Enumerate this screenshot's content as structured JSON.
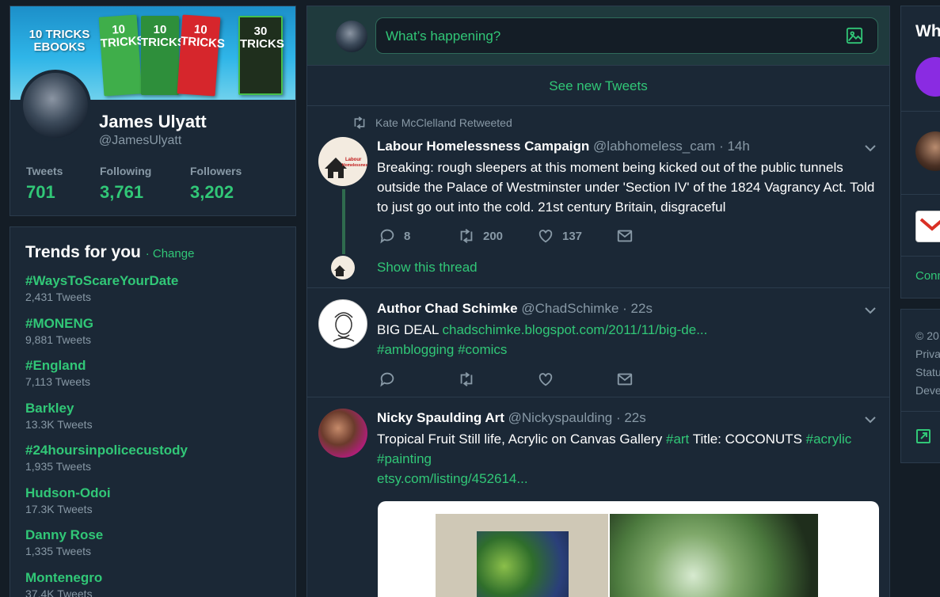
{
  "profile": {
    "banner_title": "10 TRICKS EBOOKS",
    "books": [
      "10 TRICKS",
      "10 TRICKS",
      "10 TRICKS",
      "30 TRICKS"
    ],
    "name": "James Ulyatt",
    "handle": "@JamesUlyatt",
    "stats": [
      {
        "label": "Tweets",
        "value": "701"
      },
      {
        "label": "Following",
        "value": "3,761"
      },
      {
        "label": "Followers",
        "value": "3,202"
      }
    ]
  },
  "trends": {
    "title": "Trends for you",
    "change": "· Change",
    "items": [
      {
        "name": "#WaysToScareYourDate",
        "count": "2,431 Tweets"
      },
      {
        "name": "#MONENG",
        "count": "9,881 Tweets"
      },
      {
        "name": "#England",
        "count": "7,113 Tweets"
      },
      {
        "name": "Barkley",
        "count": "13.3K Tweets"
      },
      {
        "name": "#24hoursinpolicecustody",
        "count": "1,935 Tweets"
      },
      {
        "name": "Hudson-Odoi",
        "count": "17.3K Tweets"
      },
      {
        "name": "Danny Rose",
        "count": "1,335 Tweets"
      },
      {
        "name": "Montenegro",
        "count": "37.4K Tweets"
      }
    ]
  },
  "compose": {
    "placeholder": "What’s happening?"
  },
  "see_new": "See new Tweets",
  "tweets": [
    {
      "context": "Kate McClelland Retweeted",
      "name": "Labour Homelessness Campaign",
      "handle": "@labhomeless_cam",
      "time": "· 14h",
      "avatar_text": "Labour Homelessness Campaign",
      "body": "Breaking: rough sleepers at this moment being kicked out of the public tunnels outside the Palace of Westminster under 'Section IV' of the 1824 Vagrancy Act. Told to just go out into the cold. 21st century Britain, disgraceful",
      "replies": "8",
      "retweets": "200",
      "likes": "137",
      "show_thread": "Show this thread"
    },
    {
      "name": "Author Chad Schimke",
      "handle": "@ChadSchimke",
      "time": "· 22s",
      "body_text": "BIG DEAL ",
      "link": "chadschimke.blogspot.com/2011/11/big-de...",
      "hashtags": "#amblogging #comics"
    },
    {
      "name": "Nicky Spaulding Art",
      "handle": "@Nickyspaulding",
      "time": "· 22s",
      "body_1": "Tropical Fruit Still life, Acrylic on Canvas Gallery ",
      "tag_1": "#art",
      "body_2": " Title: COCONUTS ",
      "tag_2": "#acrylic",
      "tag_3": "#painting",
      "link": "etsy.com/listing/452614..."
    }
  ],
  "right": {
    "heading_fragment": "Wh",
    "connect_fragment": "Conn",
    "footer": [
      "© 20",
      "Priva",
      "Statu",
      "Deve"
    ]
  },
  "colors": {
    "accent": "#31c777",
    "background": "#141d26",
    "panel": "#1b2836",
    "muted": "#8899a6"
  }
}
